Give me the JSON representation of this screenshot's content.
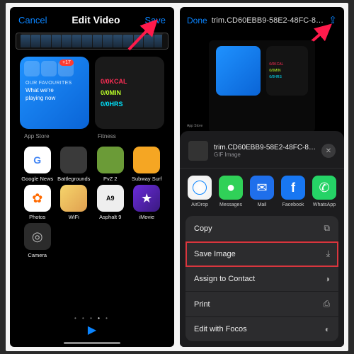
{
  "left": {
    "cancel": "Cancel",
    "title": "Edit Video",
    "save": "Save",
    "widget_blue": {
      "badge": "+17",
      "heading": "OUR FAVOURITES",
      "sub1": "What we're",
      "sub2": "playing now"
    },
    "widget_labels": {
      "left": "App Store",
      "right": "Fitness"
    },
    "rings": {
      "r1": "0/0KCAL",
      "r2": "0/0MIN",
      "r3": "0/0HRS"
    },
    "apps": [
      {
        "label": "Google News",
        "cls": "ic-gnews"
      },
      {
        "label": "Battlegrounds",
        "cls": "ic-battle"
      },
      {
        "label": "PvZ 2",
        "cls": "ic-pvz"
      },
      {
        "label": "Subway Surf",
        "cls": "ic-subway"
      },
      {
        "label": "Photos",
        "cls": "ic-photos"
      },
      {
        "label": "WiFi",
        "cls": "ic-wifi"
      },
      {
        "label": "Asphalt 9",
        "cls": "ic-asphalt",
        "text": "A9"
      },
      {
        "label": "iMovie",
        "cls": "ic-imovie"
      },
      {
        "label": "Camera",
        "cls": "ic-camera"
      }
    ]
  },
  "right": {
    "done": "Done",
    "filename_header": "trim.CD60EBB9-58E2-48FC-855…",
    "sheet_filename": "trim.CD60EBB9-58E2-48FC-8552-7…",
    "sheet_filetype": "GIF Image",
    "share_apps": [
      {
        "label": "AirDrop",
        "cls": "s-airdrop"
      },
      {
        "label": "Messages",
        "cls": "s-msg"
      },
      {
        "label": "Mail",
        "cls": "s-mail"
      },
      {
        "label": "Facebook",
        "cls": "s-fb",
        "text": "f"
      },
      {
        "label": "WhatsApp",
        "cls": "s-wa"
      }
    ],
    "actions": [
      {
        "label": "Copy",
        "icon": "⧉",
        "hl": false
      },
      {
        "label": "Save Image",
        "icon": "⤓",
        "hl": true
      },
      {
        "label": "Assign to Contact",
        "icon": "◑",
        "hl": false
      },
      {
        "label": "Print",
        "icon": "⎙",
        "hl": false
      },
      {
        "label": "Edit with Focos",
        "icon": "◐",
        "hl": false
      }
    ]
  }
}
